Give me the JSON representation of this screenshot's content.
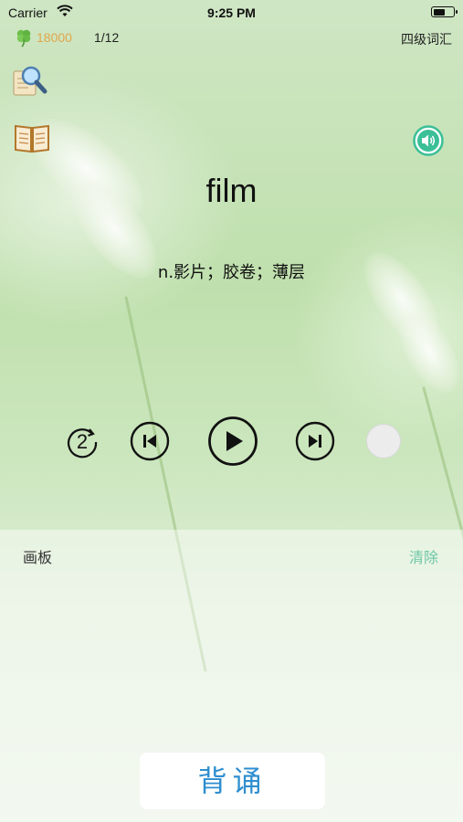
{
  "status_bar": {
    "carrier": "Carrier",
    "time": "9:25 PM"
  },
  "header": {
    "score": "18000",
    "progress": "1/12",
    "category": "四级词汇",
    "score_color": "#e0a64a"
  },
  "toolbar_icons": [
    "magnifier-icon",
    "book-icon",
    "speaker-icon"
  ],
  "card": {
    "word": "film",
    "meaning": "n.影片；胶卷；薄层"
  },
  "controls": {
    "repeat_count": "2"
  },
  "board": {
    "title": "画板",
    "clear_label": "清除",
    "clear_color": "#6dc7a6"
  },
  "footer": {
    "recite_label": "背诵",
    "recite_color": "#2f8ed0"
  }
}
